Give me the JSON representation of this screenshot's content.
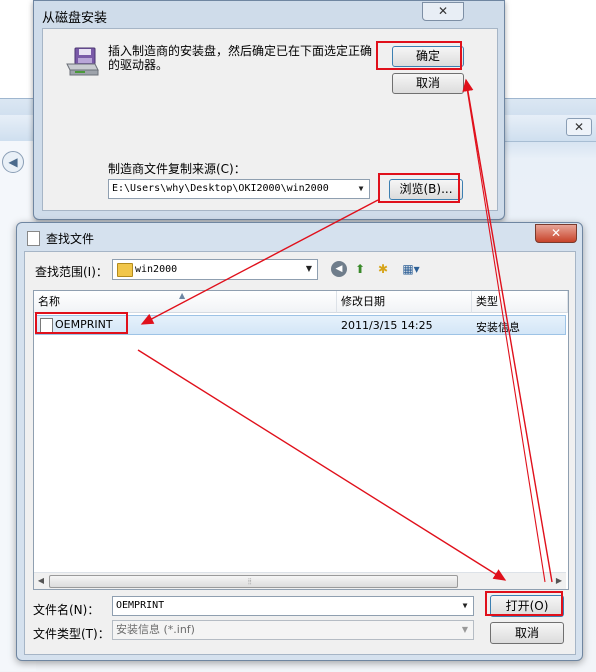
{
  "disk_dialog": {
    "title": "从磁盘安装",
    "close_glyph": "✕",
    "message": "插入制造商的安装盘，然后确定已在下面选定正确的驱动器。",
    "ok_label": "确定",
    "cancel_label": "取消",
    "source_label": "制造商文件复制来源(C)：",
    "source_value": "E:\\Users\\why\\Desktop\\OKI2000\\win2000",
    "browse_label": "浏览(B)..."
  },
  "find_dialog": {
    "title": "查找文件",
    "close_glyph": "✕",
    "look_in_label": "查找范围(I)：",
    "look_in_value": "win2000",
    "columns": {
      "name": "名称",
      "date": "修改日期",
      "type": "类型"
    },
    "files": [
      {
        "name": "OEMPRINT",
        "date": "2011/3/15 14:25",
        "type": "安装信息"
      }
    ],
    "file_name_label": "文件名(N)：",
    "file_name_value": "OEMPRINT",
    "file_type_label": "文件类型(T)：",
    "file_type_value": "安装信息 (*.inf)",
    "open_label": "打开(O)",
    "cancel_label": "取消"
  },
  "colors": {
    "highlight": "#e0101b",
    "dialog_frame": "#cfdcea",
    "selected_row": "#d4e6f7"
  },
  "icons": {
    "disk": "floppy-drive-icon",
    "back": "back-arrow-icon",
    "up": "up-folder-icon",
    "new_folder": "new-folder-icon",
    "view": "view-menu-icon"
  }
}
